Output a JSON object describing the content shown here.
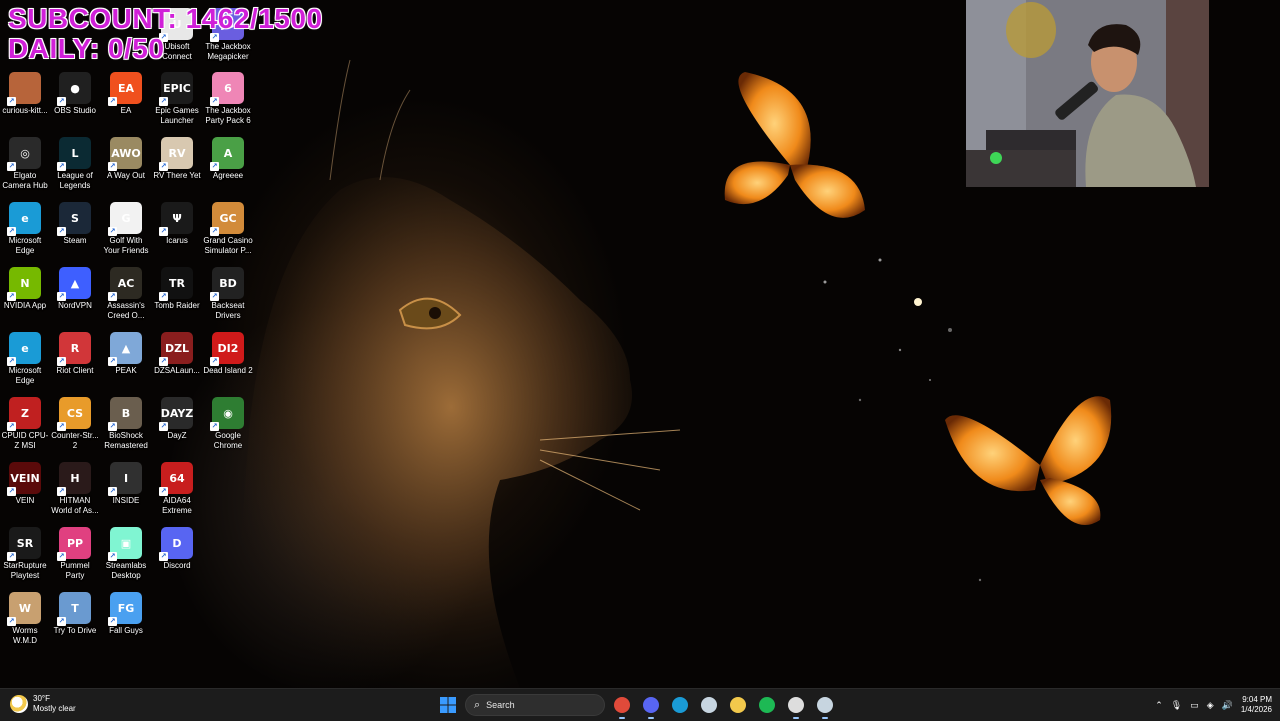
{
  "overlay": {
    "subcount": "SUBCOUNT: 1462/1500",
    "daily": "DAILY: 0/50"
  },
  "desktop_icons": [
    {
      "label": "Ubisoft Connect",
      "icon": "ubisoft-icon",
      "color": "#e8e8e8",
      "glyph": "U"
    },
    {
      "label": "The Jackbox Megapicker",
      "icon": "jackbox-icon",
      "color": "#6a5ee0",
      "glyph": "JB"
    },
    {
      "label": "curious-kitt...",
      "icon": "image-file-icon",
      "color": "#b7643a",
      "glyph": ""
    },
    {
      "label": "OBS Studio",
      "icon": "obs-icon",
      "color": "#202020",
      "glyph": "●"
    },
    {
      "label": "EA",
      "icon": "ea-icon",
      "color": "#f0501e",
      "glyph": "EA"
    },
    {
      "label": "Epic Games Launcher",
      "icon": "epic-games-icon",
      "color": "#1b1b1b",
      "glyph": "EPIC"
    },
    {
      "label": "The Jackbox Party Pack 6",
      "icon": "jackbox-pp6-icon",
      "color": "#ef86b6",
      "glyph": "6"
    },
    {
      "label": "Elgato Camera Hub",
      "icon": "elgato-icon",
      "color": "#2a2a2a",
      "glyph": "◎"
    },
    {
      "label": "League of Legends",
      "icon": "league-icon",
      "color": "#0b2a33",
      "glyph": "L"
    },
    {
      "label": "A Way Out",
      "icon": "a-way-out-icon",
      "color": "#9a8a62",
      "glyph": "AWO"
    },
    {
      "label": "RV There Yet",
      "icon": "rv-there-yet-icon",
      "color": "#d8c8b0",
      "glyph": "RV"
    },
    {
      "label": "Agreeee",
      "icon": "agreeee-icon",
      "color": "#4aa046",
      "glyph": "A"
    },
    {
      "label": "Microsoft Edge",
      "icon": "edge-icon",
      "color": "#1a9bd6",
      "glyph": "e"
    },
    {
      "label": "Steam",
      "icon": "steam-icon",
      "color": "#1b2838",
      "glyph": "S"
    },
    {
      "label": "Golf With Your Friends",
      "icon": "golf-icon",
      "color": "#f2f2f2",
      "glyph": "G"
    },
    {
      "label": "Icarus",
      "icon": "icarus-icon",
      "color": "#1a1a1a",
      "glyph": "Ψ"
    },
    {
      "label": "Grand Casino Simulator P...",
      "icon": "casino-icon",
      "color": "#d28b3a",
      "glyph": "GC"
    },
    {
      "label": "NVIDIA App",
      "icon": "nvidia-icon",
      "color": "#76b900",
      "glyph": "N"
    },
    {
      "label": "NordVPN",
      "icon": "nordvpn-icon",
      "color": "#3e5fff",
      "glyph": "▲"
    },
    {
      "label": "Assassin's Creed O...",
      "icon": "assassins-creed-icon",
      "color": "#2d2a22",
      "glyph": "AC"
    },
    {
      "label": "Tomb Raider",
      "icon": "tomb-raider-icon",
      "color": "#111111",
      "glyph": "TR"
    },
    {
      "label": "Backseat Drivers",
      "icon": "backseat-drivers-icon",
      "color": "#222222",
      "glyph": "BD"
    },
    {
      "label": "Microsoft Edge",
      "icon": "edge-icon",
      "color": "#1a9bd6",
      "glyph": "e"
    },
    {
      "label": "Riot Client",
      "icon": "riot-icon",
      "color": "#d13639",
      "glyph": "R"
    },
    {
      "label": "PEAK",
      "icon": "peak-icon",
      "color": "#7fa8d8",
      "glyph": "▲"
    },
    {
      "label": "DZSALaun...",
      "icon": "dzsa-icon",
      "color": "#8a1e1e",
      "glyph": "DZL"
    },
    {
      "label": "Dead Island 2",
      "icon": "dead-island-icon",
      "color": "#d01a1a",
      "glyph": "DI2"
    },
    {
      "label": "CPUID CPU-Z MSI",
      "icon": "cpuz-icon",
      "color": "#c02020",
      "glyph": "Z"
    },
    {
      "label": "Counter-Str... 2",
      "icon": "counter-strike-icon",
      "color": "#e89b2a",
      "glyph": "CS"
    },
    {
      "label": "BioShock Remastered",
      "icon": "bioshock-icon",
      "color": "#6a5e4e",
      "glyph": "B"
    },
    {
      "label": "DayZ",
      "icon": "dayz-icon",
      "color": "#2a2a2a",
      "glyph": "DAYZ"
    },
    {
      "label": "Google Chrome",
      "icon": "chrome-icon",
      "color": "#2e7d32",
      "glyph": "◉"
    },
    {
      "label": "VEIN",
      "icon": "vein-icon",
      "color": "#5a0a0a",
      "glyph": "VEIN"
    },
    {
      "label": "HITMAN World of As...",
      "icon": "hitman-icon",
      "color": "#2a1a1a",
      "glyph": "H"
    },
    {
      "label": "INSIDE",
      "icon": "inside-icon",
      "color": "#303030",
      "glyph": "I"
    },
    {
      "label": "AIDA64 Extreme",
      "icon": "aida64-icon",
      "color": "#c81e1e",
      "glyph": "64"
    },
    {
      "label": "StarRupture Playtest",
      "icon": "starrupture-icon",
      "color": "#1a1a1a",
      "glyph": "SR"
    },
    {
      "label": "Pummel Party",
      "icon": "pummel-party-icon",
      "color": "#e04080",
      "glyph": "PP"
    },
    {
      "label": "Streamlabs Desktop",
      "icon": "streamlabs-icon",
      "color": "#80f5d2",
      "glyph": "▣"
    },
    {
      "label": "Discord",
      "icon": "discord-icon",
      "color": "#5865f2",
      "glyph": "D"
    },
    {
      "label": "Worms W.M.D",
      "icon": "worms-icon",
      "color": "#c8a070",
      "glyph": "W"
    },
    {
      "label": "Try To Drive",
      "icon": "try-to-drive-icon",
      "color": "#6a9ad0",
      "glyph": "T"
    },
    {
      "label": "Fall Guys",
      "icon": "fall-guys-icon",
      "color": "#4aa0f0",
      "glyph": "FG"
    }
  ],
  "taskbar": {
    "weather": {
      "temp": "30°F",
      "condition": "Mostly clear"
    },
    "search_placeholder": "Search",
    "pinned": [
      {
        "icon": "windows-start-icon",
        "color": "#3a9bff",
        "active": false
      },
      {
        "icon": "chrome-icon",
        "color": "#e04a3a",
        "active": true
      },
      {
        "icon": "discord-icon",
        "color": "#5865f2",
        "active": true
      },
      {
        "icon": "edge-icon",
        "color": "#1a9bd6",
        "active": false
      },
      {
        "icon": "steam-icon",
        "color": "#c7d5e0",
        "active": false
      },
      {
        "icon": "file-explorer-icon",
        "color": "#f2c94c",
        "active": false
      },
      {
        "icon": "spotify-icon",
        "color": "#1db954",
        "active": false
      },
      {
        "icon": "obs-icon",
        "color": "#dddddd",
        "active": true
      },
      {
        "icon": "steam-icon",
        "color": "#c7d5e0",
        "active": true
      }
    ],
    "clock": {
      "time": "9:04 PM",
      "date": "1/4/2026"
    }
  }
}
